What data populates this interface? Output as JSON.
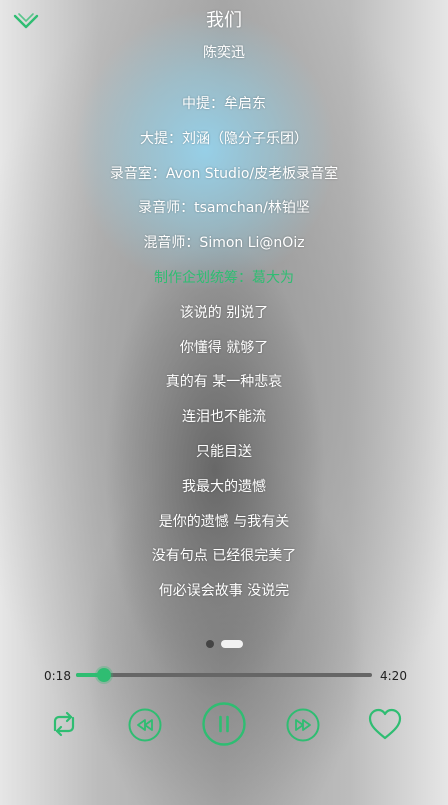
{
  "header": {
    "collapse_icon": "chevron-down-icon",
    "title": "我们",
    "artist": "陈奕迅"
  },
  "lyrics": [
    {
      "text": "中提：牟启东"
    },
    {
      "text": "大提：刘涵（隐分子乐团）"
    },
    {
      "text": "录音室：Avon Studio/皮老板录音室"
    },
    {
      "text": "录音师：tsamchan/林铂坚"
    },
    {
      "text": "混音师：Simon Li@nOiz"
    },
    {
      "text": "制作企划统筹：葛大为",
      "active": true
    },
    {
      "text": "该说的 别说了"
    },
    {
      "text": "你懂得 就够了"
    },
    {
      "text": "真的有 某一种悲哀"
    },
    {
      "text": "连泪也不能流"
    },
    {
      "text": "只能目送"
    },
    {
      "text": "我最大的遗憾"
    },
    {
      "text": "是你的遗憾 与我有关"
    },
    {
      "text": "没有句点 已经很完美了"
    },
    {
      "text": "何必误会故事 没说完"
    }
  ],
  "pager": {
    "count": 2,
    "active_index": 1
  },
  "player": {
    "current_time": "0:18",
    "total_time": "4:20",
    "progress": 0.096,
    "state": "playing"
  },
  "controls": {
    "loop_icon": "repeat-icon",
    "prev_icon": "previous-track-icon",
    "play_pause_icon": "pause-icon",
    "next_icon": "next-track-icon",
    "like_icon": "heart-icon"
  },
  "colors": {
    "accent": "#2fbd72",
    "text": "#ffffff",
    "time_text": "#222222",
    "track": "#666666"
  }
}
